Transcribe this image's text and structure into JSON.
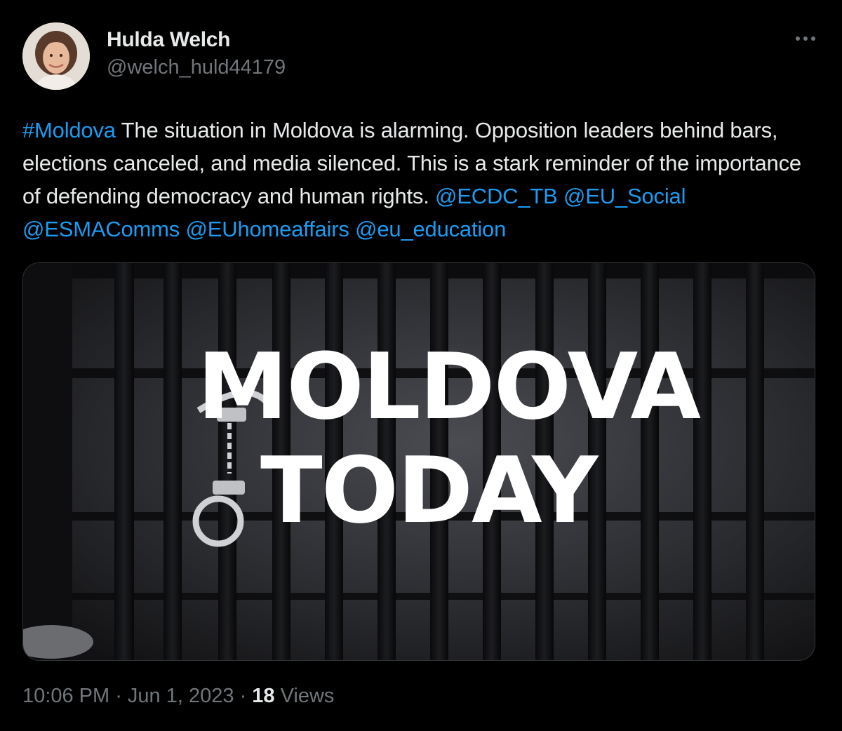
{
  "author": {
    "display_name": "Hulda Welch",
    "handle": "@welch_huld44179"
  },
  "tweet": {
    "hashtag": "#Moldova",
    "body": " The situation in Moldova is alarming. Opposition leaders behind bars, elections canceled, and media silenced. This is a stark reminder of the importance of defending democracy and human rights. ",
    "mentions": [
      "@ECDC_TB",
      "@EU_Social",
      "@ESMAComms",
      "@EUhomeaffairs",
      "@eu_education"
    ]
  },
  "media": {
    "title_line1": "MOLDOVA",
    "title_line2": "TODAY",
    "icons": [
      "prison-bars-background",
      "handcuffs-icon"
    ]
  },
  "meta": {
    "time": "10:06 PM",
    "separator": " · ",
    "date": "Jun 1, 2023",
    "views_count": "18",
    "views_label": " Views"
  },
  "icons": {
    "more": "more-horizontal-icon"
  },
  "colors": {
    "background": "#000000",
    "text": "#e7e9ea",
    "secondary": "#71767b",
    "link": "#1d9bf0",
    "border": "#2f3336"
  }
}
